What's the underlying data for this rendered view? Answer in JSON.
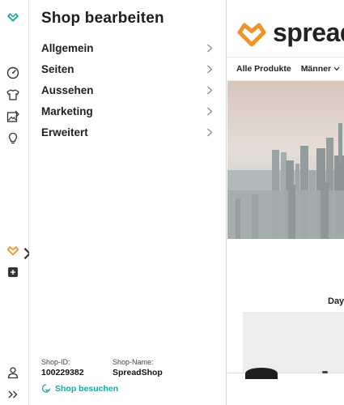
{
  "panel": {
    "title": "Shop bearbeiten",
    "menu": [
      {
        "label": "Allgemein"
      },
      {
        "label": "Seiten"
      },
      {
        "label": "Aussehen"
      },
      {
        "label": "Marketing"
      },
      {
        "label": "Erweitert"
      }
    ]
  },
  "shop": {
    "id_label": "Shop-ID:",
    "id_value": "100229382",
    "name_label": "Shop-Name:",
    "name_value": "SpreadShop",
    "visit_label": "Shop besuchen"
  },
  "preview": {
    "brand": "spread",
    "nav": [
      "Alle Produkte",
      "Männer"
    ],
    "section_heading": "Day"
  },
  "colors": {
    "accent_teal": "#1aa79a",
    "brand_orange": "#f0932b"
  },
  "icons": {
    "rail": [
      "spreadshop-logo-icon",
      "dashboard-gauge-icon",
      "tshirt-icon",
      "image-edit-icon",
      "lightbulb-icon",
      "heart-shop-icon",
      "add-icon",
      "user-icon",
      "expand-double-chevron-icon"
    ]
  }
}
